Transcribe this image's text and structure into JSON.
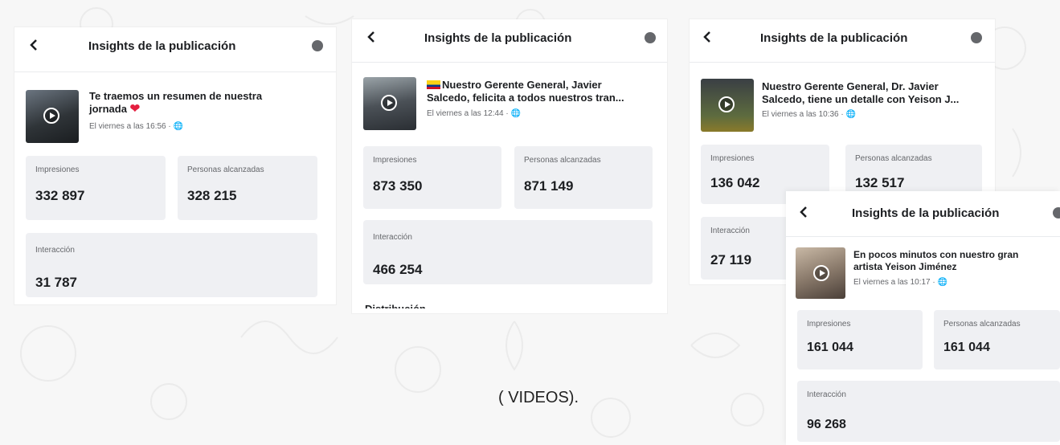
{
  "caption": "( VIDEOS).",
  "header_title": "Insights de la publicación",
  "labels": {
    "impressions": "Impresiones",
    "reach": "Personas alcanzadas",
    "engagement": "Interacción",
    "next_section": "Distribución"
  },
  "panels": [
    {
      "post_line1": "Te traemos un resumen de nuestra",
      "post_line2": "jornada",
      "post_emoji": "❤️",
      "post_meta": "El viernes a las 16:56 · 🌐",
      "impressions": "332 897",
      "reach": "328 215",
      "engagement": "31 787"
    },
    {
      "post_line1": "Nuestro Gerente General, Javier",
      "post_line2": "Salcedo, felicita a todos nuestros tran...",
      "post_meta": "El viernes a las 12:44 · 🌐",
      "impressions": "873 350",
      "reach": "871 149",
      "engagement": "466 254"
    },
    {
      "post_line1": "Nuestro Gerente General, Dr. Javier",
      "post_line2": "Salcedo, tiene un detalle con Yeison J...",
      "post_meta": "El viernes a las 10:36 · 🌐",
      "impressions": "136 042",
      "reach": "132 517",
      "engagement": "27 119"
    },
    {
      "post_line1": "En pocos minutos con nuestro gran",
      "post_line2": "artista Yeison Jiménez",
      "post_meta": "El viernes a las 10:17 · 🌐",
      "impressions": "161 044",
      "reach": "161 044",
      "engagement": "96 268"
    }
  ],
  "colors": {
    "background": "#f7f7f7",
    "panel": "#ffffff",
    "card": "#eff0f3",
    "text": "#1c1e21",
    "muted": "#65676b",
    "heart": "#e41e3f"
  },
  "icons": [
    "back-arrow-icon",
    "info-icon",
    "play-icon",
    "globe-icon",
    "heart-icon",
    "colombia-flag-icon"
  ]
}
